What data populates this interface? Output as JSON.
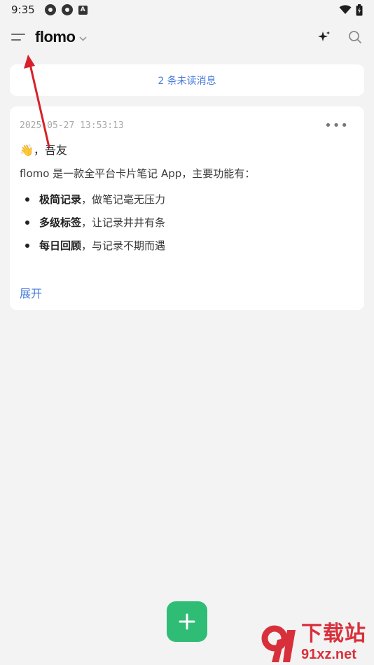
{
  "status_bar": {
    "time": "9:35",
    "left_icons": [
      "app-notification-icon",
      "app-notification-icon",
      "a-icon"
    ],
    "right_icons": [
      "wifi-icon",
      "battery-icon"
    ]
  },
  "header": {
    "title": "flomo",
    "menu_icon": "menu-icon",
    "right_icons": [
      "sparkle-icon",
      "search-icon"
    ]
  },
  "unread_banner": {
    "text": "2 条未读消息",
    "color": "#4a7cdb"
  },
  "memo": {
    "timestamp": "2025-05-27 13:53:13",
    "greeting": "👋，吾友",
    "intro": "flomo 是一款全平台卡片笔记 App，主要功能有：",
    "items": [
      {
        "bold": "极简记录",
        "rest": "，做笔记毫无压力"
      },
      {
        "bold": "多级标签",
        "rest": "，让记录井井有条"
      },
      {
        "bold": "每日回顾",
        "rest": "，与记录不期而遇"
      }
    ],
    "expand_label": "展开"
  },
  "fab": {
    "icon": "plus-icon",
    "color": "#2fbd76"
  },
  "watermark": {
    "title": "下载站",
    "url": "91xz.net",
    "color": "#d8303b"
  }
}
